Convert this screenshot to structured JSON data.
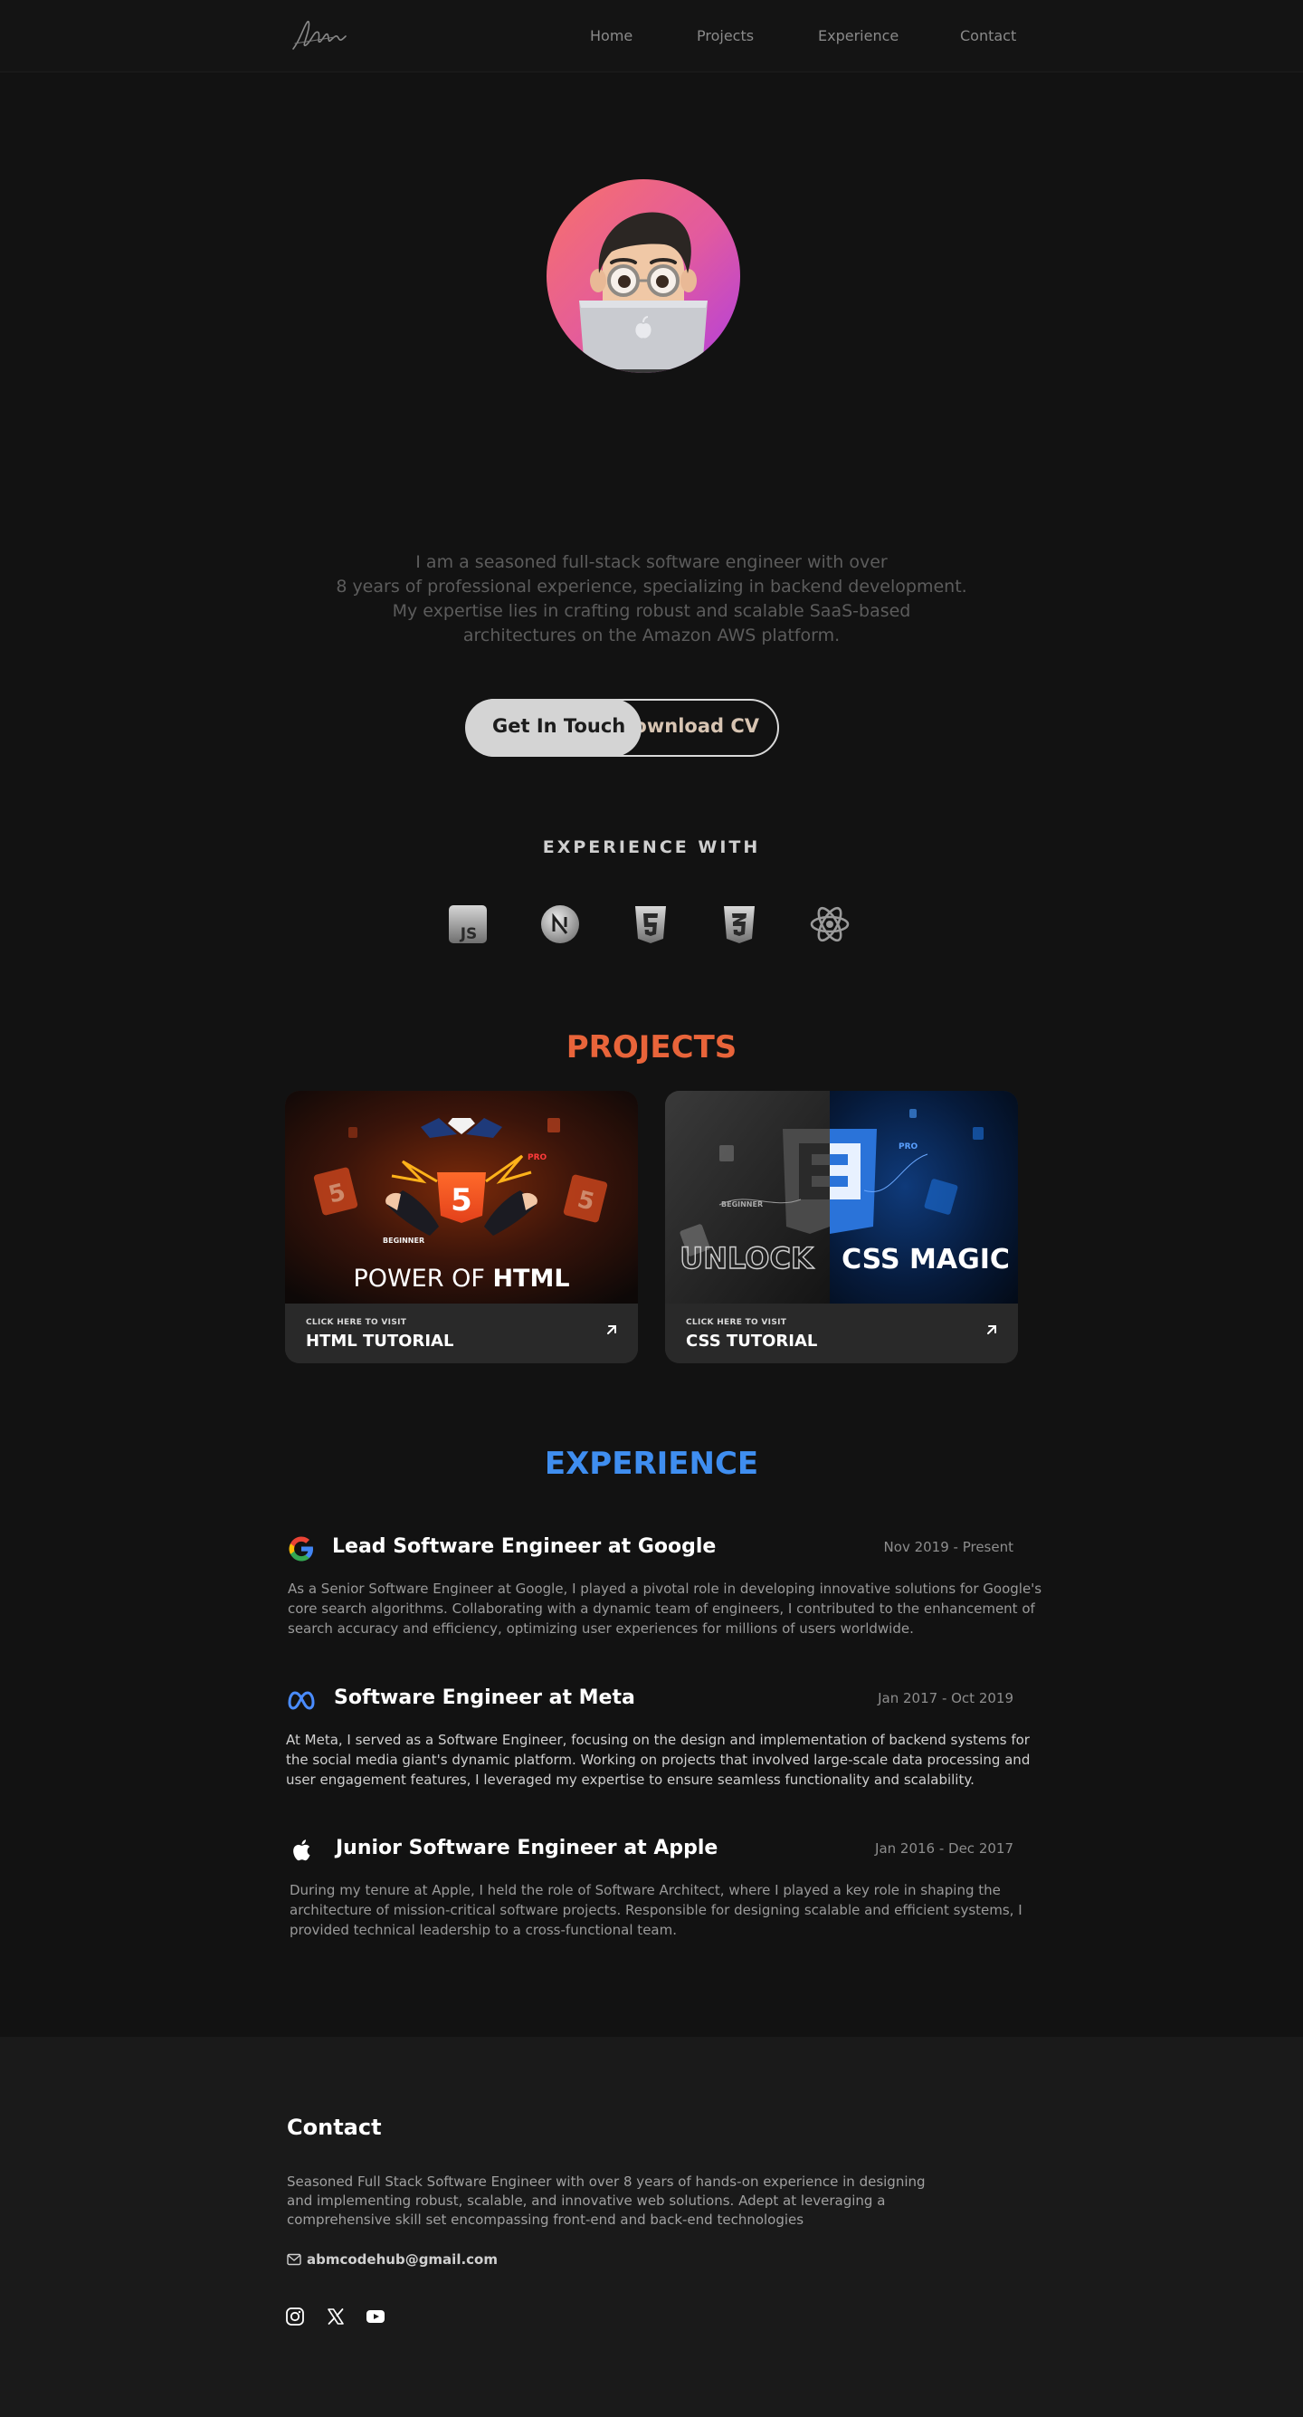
{
  "nav": {
    "items": [
      "Home",
      "Projects",
      "Experience",
      "Contact"
    ]
  },
  "hero": {
    "intro_lines": [
      "I am a seasoned full-stack software engineer with over",
      "8 years of professional experience, specializing in backend development.",
      "My expertise lies in crafting robust and scalable SaaS-based",
      "architectures on the Amazon AWS platform."
    ],
    "get_in_touch": "Get In Touch",
    "download_cv": "Download CV"
  },
  "experience_with": {
    "title": "EXPERIENCE WITH",
    "icons": [
      "javascript-icon",
      "nextjs-icon",
      "html5-icon",
      "css3-icon",
      "react-icon"
    ]
  },
  "projects": {
    "title": "PROJECTS",
    "title_color": "#e8643a",
    "cards": [
      {
        "image_text_prefix": "POWER OF ",
        "image_text_bold": "HTML",
        "image_tag_pro": "PRO",
        "image_tag_beginner": "BEGINNER",
        "small": "CLICK HERE TO VISIT",
        "name": "HTML TUTORIAL"
      },
      {
        "image_text_left": "UNLOCK",
        "image_text_right": "CSS MAGIC",
        "image_tag_pro": "PRO",
        "image_tag_beginner": "BEGINNER",
        "small": "CLICK HERE TO VISIT",
        "name": "CSS TUTORIAL"
      }
    ]
  },
  "experience": {
    "title": "EXPERIENCE",
    "title_color": "#3f8ef0",
    "jobs": [
      {
        "company_icon": "google-icon",
        "title": "Lead Software Engineer at Google",
        "date": "Nov 2019 - Present",
        "lines": [
          "As a Senior Software Engineer at Google, I played a pivotal role in developing innovative solutions for Google's",
          "core search algorithms. Collaborating with a dynamic team of engineers, I contributed to the enhancement of",
          "search accuracy and efficiency, optimizing user experiences for millions of users worldwide."
        ]
      },
      {
        "company_icon": "meta-icon",
        "title": "Software Engineer at Meta",
        "date": "Jan 2017 - Oct 2019",
        "lines": [
          "At Meta, I served as a  Software Engineer, focusing on the design and implementation of backend systems for",
          "the social media giant's dynamic platform. Working on projects that involved large-scale data processing and",
          "user engagement features, I leveraged my expertise to ensure seamless functionality and scalability."
        ]
      },
      {
        "company_icon": "apple-icon",
        "title": "Junior Software Engineer at Apple",
        "date": "Jan 2016 - Dec 2017",
        "lines": [
          "During my tenure at Apple, I held the role of Software Architect, where I played a key role in shaping the",
          "architecture of mission-critical software projects. Responsible for designing scalable and efficient systems, I",
          "provided technical leadership to a cross-functional team."
        ]
      }
    ]
  },
  "contact": {
    "title": "Contact",
    "lines": [
      "Seasoned Full Stack Software Engineer with over 8 years of hands-on experience in designing",
      "and implementing robust, scalable, and innovative web solutions. Adept at leveraging a",
      "comprehensive skill set encompassing front-end and back-end technologies"
    ],
    "email": "abmcodehub@gmail.com",
    "socials": [
      "instagram-icon",
      "x-icon",
      "youtube-icon"
    ]
  }
}
